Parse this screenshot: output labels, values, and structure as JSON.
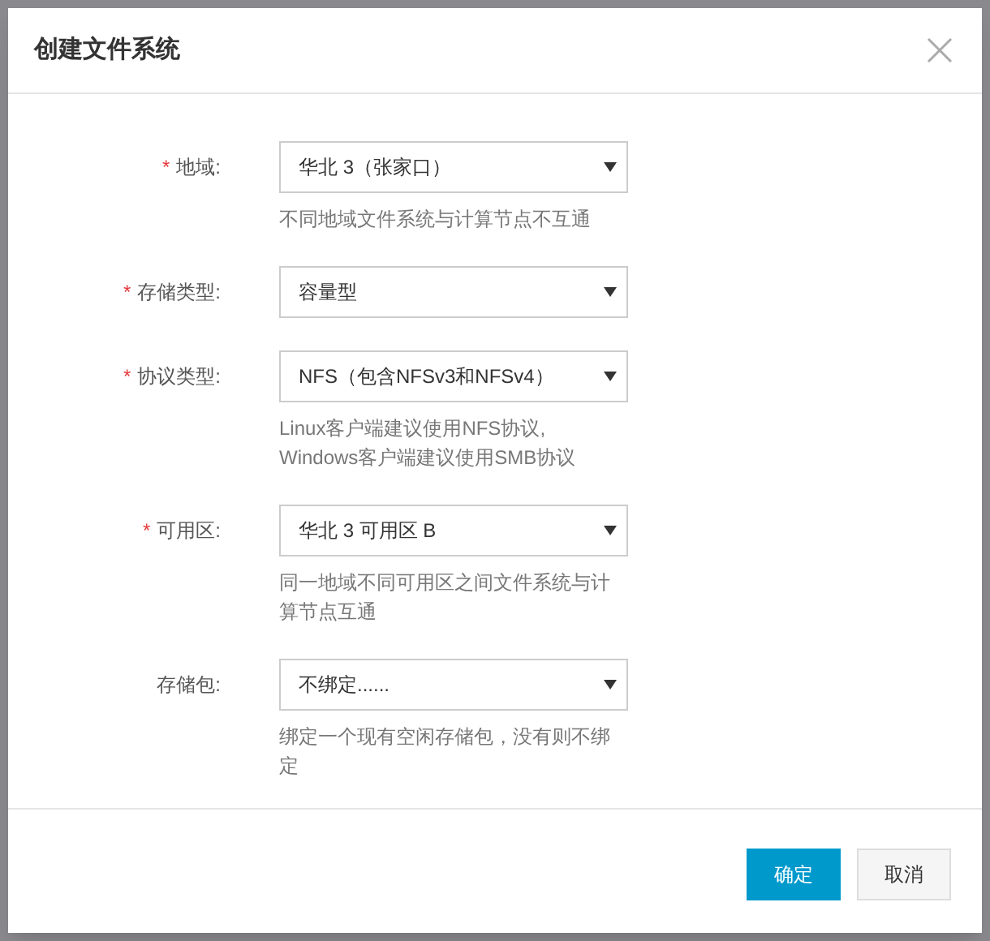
{
  "dialog": {
    "title": "创建文件系统"
  },
  "fields": [
    {
      "label": "地域:",
      "required": true,
      "value": "华北 3（张家口）",
      "hint": "不同地域文件系统与计算节点不互通"
    },
    {
      "label": "存储类型:",
      "required": true,
      "value": "容量型"
    },
    {
      "label": "协议类型:",
      "required": true,
      "value": "NFS（包含NFSv3和NFSv4）",
      "hint": "Linux客户端建议使用NFS协议,\nWindows客户端建议使用SMB协议"
    },
    {
      "label": "可用区:",
      "required": true,
      "value": "华北 3 可用区 B",
      "hint": "同一地域不同可用区之间文件系统与计算节点互通"
    },
    {
      "label": "存储包:",
      "required": false,
      "value": "不绑定......",
      "hint": "绑定一个现有空闲存储包，没有则不绑定"
    }
  ],
  "required_mark": "*",
  "buttons": [
    {
      "kind": "primary",
      "label": "确定"
    },
    {
      "kind": "secondary",
      "label": "取消"
    }
  ]
}
